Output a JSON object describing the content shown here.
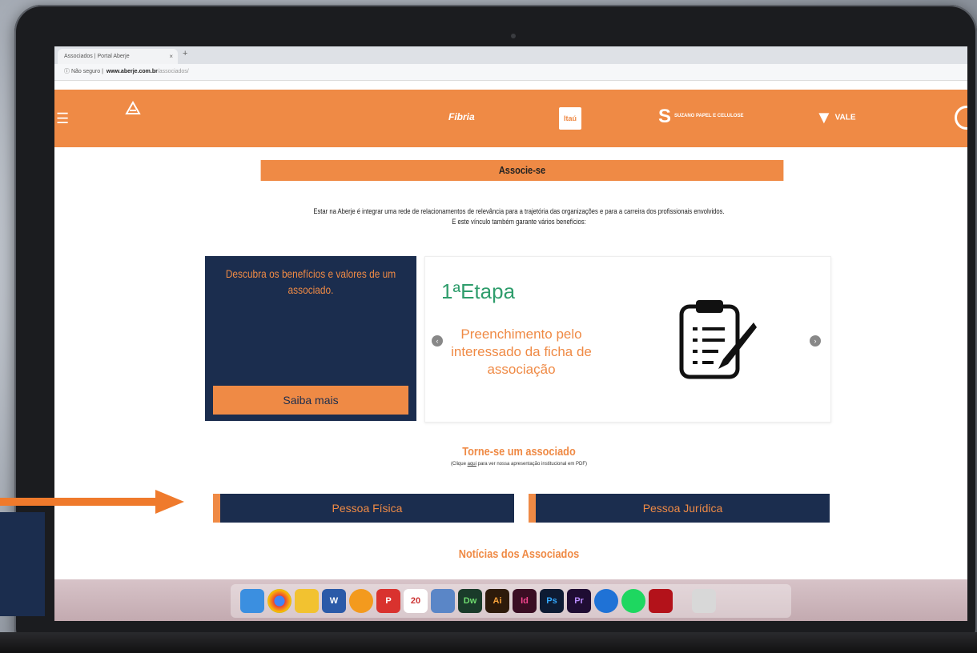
{
  "browser": {
    "tab_title": "Associados | Portal Aberje",
    "tab_close": "×",
    "new_tab": "+",
    "url_security": "ⓘ Não seguro |",
    "url_domain": "www.aberje.com.br",
    "url_path": "/associados/"
  },
  "header": {
    "menu_icon": "☰",
    "partners": [
      "Fibria",
      "Itaú",
      "S",
      "SUZANO PAPEL E CELULOSE",
      "VALE"
    ]
  },
  "main": {
    "title": "Associe-se",
    "intro_line1": "Estar na Aberje é integrar uma rede de relacionamentos de relevância para a trajetória das organizações e para a carreira dos profissionais envolvidos.",
    "intro_line2": "E este vínculo também garante vários benefícios:",
    "promo_text": "Descubra os benefícios e valores de um associado.",
    "promo_button": "Saiba mais",
    "carousel": {
      "step_title": "1ªEtapa",
      "step_desc": "Preenchimento pelo interessado da ficha de associação",
      "prev": "‹",
      "next": "›"
    },
    "join_title": "Torne-se um associado",
    "join_sub_prefix": "(Clique ",
    "join_sub_link": "aqui",
    "join_sub_suffix": " para ver nossa apresentação institucional em PDF)",
    "btn_pf": "Pessoa Física",
    "btn_pj": "Pessoa Jurídica",
    "news_title": "Notícias dos Associados"
  },
  "dock": {
    "items": [
      "",
      "",
      "",
      "W",
      "",
      "P",
      "20",
      "",
      "Dw",
      "Ai",
      "Id",
      "Ps",
      "Pr",
      "",
      "",
      "",
      ""
    ]
  },
  "colors": {
    "orange": "#ef8a45",
    "navy": "#1b2d4e",
    "green": "#2f9d6c"
  }
}
